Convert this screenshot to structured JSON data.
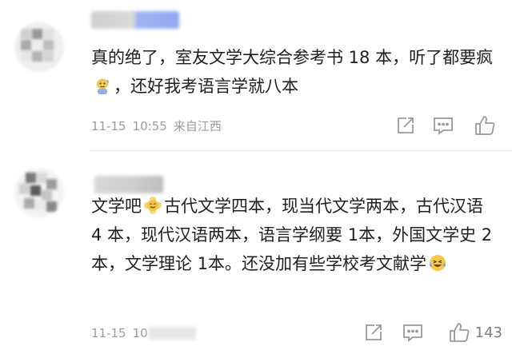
{
  "comments": [
    {
      "text_parts": [
        "真的绝了，室友文学大综合参考书 18 本，听了都要疯",
        "，还好我考语言学就八本"
      ],
      "emojis": [
        "sweating-baby-emoji"
      ],
      "date": "11-15",
      "time": "10:55",
      "location": "来自江西",
      "likes": ""
    },
    {
      "text_parts": [
        "文学吧",
        "古代文学四本，现当代文学两本，古代汉语 4 本，现代汉语两本，语言学纲要 1本，外国文学史 2 本，文学理论 1本。还没加有些学校考文献学"
      ],
      "emojis": [
        "smiling-flower-emoji",
        "laughing-tears-emoji"
      ],
      "date": "11-15",
      "time_visible": "10",
      "likes": "143"
    }
  ],
  "icons": {
    "share": "share-icon",
    "reply": "comment-icon",
    "like": "thumbs-up-icon"
  },
  "colors": {
    "text": "#1e1e1e",
    "meta": "#9b9b9b",
    "icon": "#9a9a9a",
    "name_blur_accent": "#8fa8f0"
  }
}
